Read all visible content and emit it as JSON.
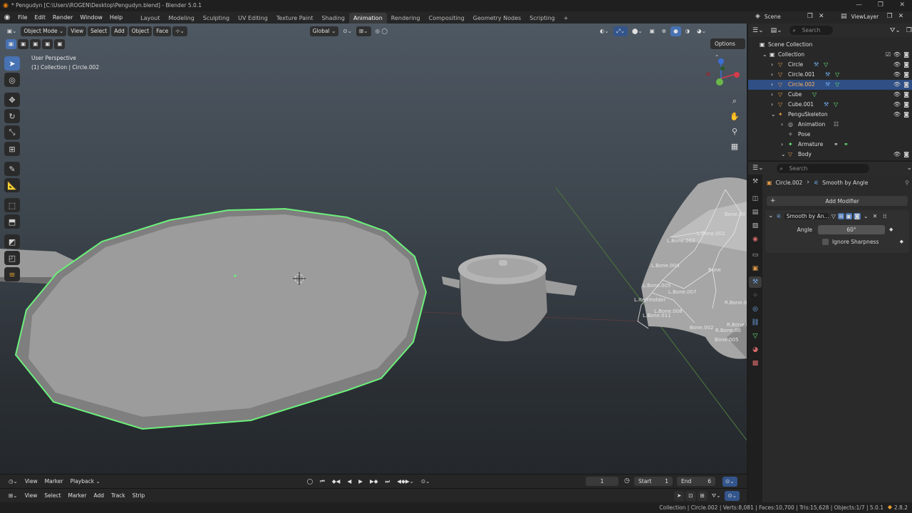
{
  "titlebar": {
    "title": "* Pengudyn [C:\\Users\\ROGEN\\Desktop\\Pengudyn.blend] - Blender 5.0.1"
  },
  "menu": [
    "File",
    "Edit",
    "Render",
    "Window",
    "Help"
  ],
  "workspaces": [
    "Layout",
    "Modeling",
    "Sculpting",
    "UV Editing",
    "Texture Paint",
    "Shading",
    "Animation",
    "Rendering",
    "Compositing",
    "Geometry Nodes",
    "Scripting"
  ],
  "active_workspace": "Animation",
  "scene": {
    "label": "Scene",
    "view_layer": "ViewLayer"
  },
  "viewport": {
    "mode": "Object Mode",
    "header_menus": [
      "View",
      "Select",
      "Add",
      "Object",
      "Face"
    ],
    "orientation": "Global",
    "options_label": "Options",
    "perspective": "User Perspective",
    "collection_info": "(1) Collection | Circle.002",
    "bone_labels": [
      "Bone.00",
      "L.Bone.002",
      "L.Bone.003",
      "L.Bone.004",
      "Bone",
      "L.Bone.005",
      "L.Bone.007",
      "L.Itemholder",
      "L.Bone.008",
      "L.Bone.011",
      "R.Bone.0",
      "Bone.002",
      "R.Bone.0",
      "R.Bone.00",
      "Bone.005"
    ]
  },
  "outliner": {
    "search_placeholder": "Search",
    "root": "Scene Collection",
    "items": [
      {
        "label": "Collection",
        "level": 0
      },
      {
        "label": "Circle",
        "level": 1
      },
      {
        "label": "Circle.001",
        "level": 1
      },
      {
        "label": "Circle.002",
        "level": 1,
        "selected": true
      },
      {
        "label": "Cube",
        "level": 1
      },
      {
        "label": "Cube.001",
        "level": 1
      },
      {
        "label": "PenguSkeleton",
        "level": 1
      },
      {
        "label": "Animation",
        "level": 2
      },
      {
        "label": "Pose",
        "level": 2
      },
      {
        "label": "Armature",
        "level": 2
      },
      {
        "label": "Body",
        "level": 2
      }
    ]
  },
  "properties": {
    "search_placeholder": "Search",
    "breadcrumb_object": "Circle.002",
    "breadcrumb_modifier": "Smooth by Angle",
    "add_modifier": "Add Modifier",
    "modifier_name": "Smooth by An...",
    "angle_label": "Angle",
    "angle_value": "60°",
    "ignore_sharpness": "Ignore Sharpness"
  },
  "timeline": {
    "menus": [
      "View",
      "Marker",
      "Playback"
    ],
    "current_frame": "1",
    "start_label": "Start",
    "start_value": "1",
    "end_label": "End",
    "end_value": "6"
  },
  "sequencer": {
    "menus": [
      "View",
      "Select",
      "Marker",
      "Add",
      "Track",
      "Strip"
    ]
  },
  "status": {
    "text": "Collection | Circle.002 | Verts:8,081 | Faces:10,700 | Tris:15,628 | Objects:1/7 | 5.0.1",
    "right": "2.8.2"
  },
  "colors": {
    "accent": "#4772b3",
    "selection_outline": "#6cf07a",
    "selected_row": "#2f4f85"
  }
}
